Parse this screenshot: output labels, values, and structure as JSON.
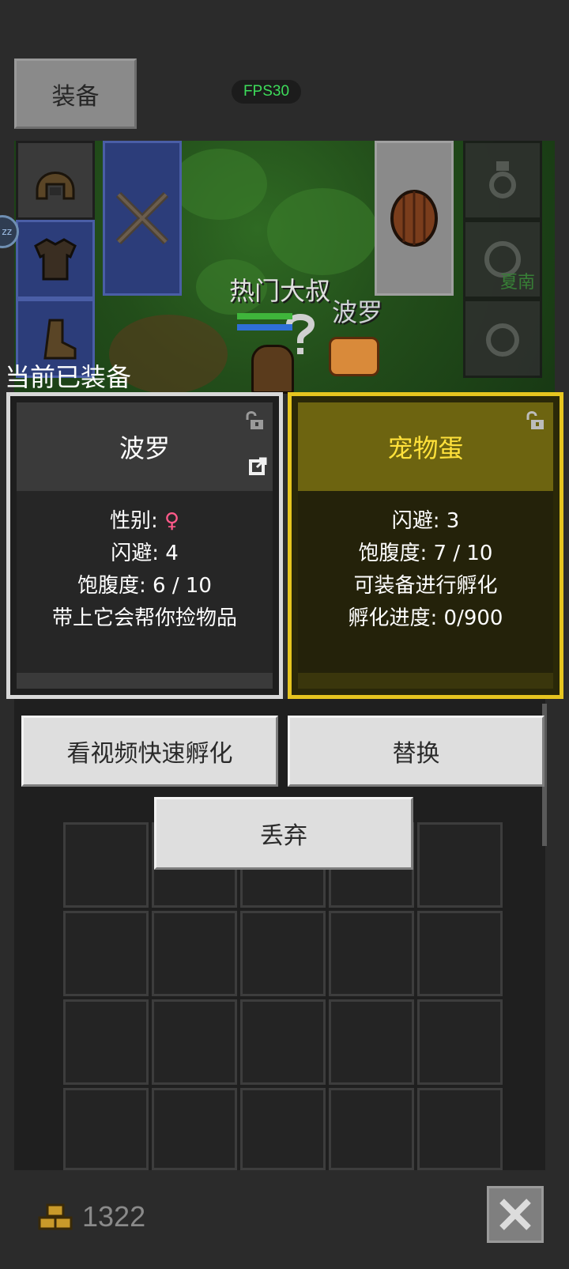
{
  "header": {
    "equip_tab": "装备",
    "fps": "FPS30"
  },
  "scene": {
    "npc_name": "热门大叔",
    "pet_name": "波罗",
    "side_badge": "zz",
    "map_hint": "夏南"
  },
  "equipped_title": "当前已装备",
  "card_current": {
    "title": "波罗",
    "lines": [
      "性别:",
      "闪避: 4",
      "饱腹度: 6 / 10",
      "带上它会帮你捡物品"
    ],
    "gender_symbol": "♀"
  },
  "card_new": {
    "title": "宠物蛋",
    "lines": [
      "闪避: 3",
      "饱腹度: 7 / 10",
      "可装备进行孵化",
      "孵化进度: 0/900"
    ]
  },
  "buttons": {
    "watch_video": "看视频快速孵化",
    "replace": "替换",
    "discard": "丢弃"
  },
  "footer": {
    "gold": "1322"
  },
  "colors": {
    "accent_yellow": "#e6c51f",
    "fps_green": "#3ddc5a",
    "female_pink": "#ff5a8a"
  },
  "icons": {
    "helmet": "helmet-icon",
    "armor": "armor-icon",
    "weapon": "crossed-swords-icon",
    "shield": "shield-icon",
    "lock": "lock-icon",
    "link": "external-link-icon",
    "gold": "gold-coins-icon",
    "close": "close-icon"
  }
}
